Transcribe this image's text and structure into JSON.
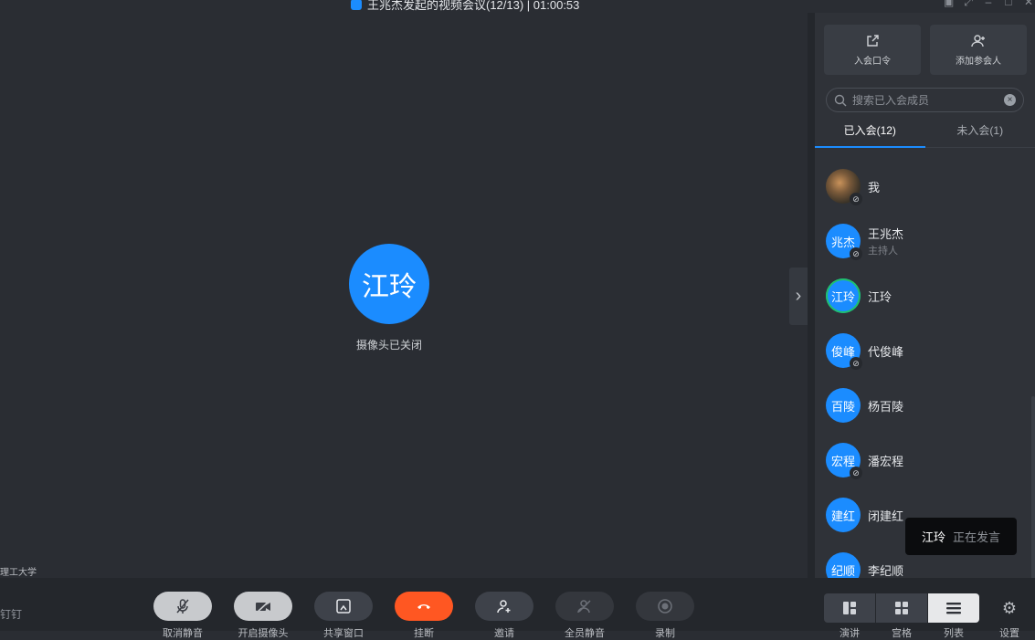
{
  "window": {
    "title": "王兆杰发起的视频会议(12/13) | 01:00:53"
  },
  "stage": {
    "speaker_avatar_text": "江玲",
    "camera_status": "摄像头已关闭",
    "org_label": "理工大学"
  },
  "sidebar": {
    "actions": [
      {
        "label": "入会口令",
        "icon": "external-link-icon"
      },
      {
        "label": "添加参会人",
        "icon": "add-user-icon"
      }
    ],
    "search_placeholder": "搜索已入会成员",
    "tabs": [
      {
        "label": "已入会(12)",
        "active": true
      },
      {
        "label": "未入会(1)",
        "active": false
      }
    ],
    "members": [
      {
        "avatar": "",
        "name": "我",
        "role": "",
        "muted": true,
        "photo": true
      },
      {
        "avatar": "兆杰",
        "name": "王兆杰",
        "role": "主持人",
        "muted": true
      },
      {
        "avatar": "江玲",
        "name": "江玲",
        "role": "",
        "muted": false,
        "speaking": true
      },
      {
        "avatar": "俊峰",
        "name": "代俊峰",
        "role": "",
        "muted": true
      },
      {
        "avatar": "百陵",
        "name": "杨百陵",
        "role": "",
        "muted": false
      },
      {
        "avatar": "宏程",
        "name": "潘宏程",
        "role": "",
        "muted": true
      },
      {
        "avatar": "建红",
        "name": "闭建红",
        "role": "",
        "muted": false
      },
      {
        "avatar": "纪顺",
        "name": "李纪顺",
        "role": "",
        "muted": false
      }
    ]
  },
  "speaking_toast": {
    "name": "江玲",
    "status": "正在发言"
  },
  "toolbar": {
    "pin_label": "钉钉",
    "buttons": [
      {
        "label": "取消静音",
        "icon": "mic-off-icon"
      },
      {
        "label": "开启摄像头",
        "icon": "camera-off-icon"
      },
      {
        "label": "共享窗口",
        "icon": "share-screen-icon"
      },
      {
        "label": "挂断",
        "icon": "hang-up-icon"
      },
      {
        "label": "邀请",
        "icon": "invite-icon"
      },
      {
        "label": "全员静音",
        "icon": "mute-all-icon"
      },
      {
        "label": "录制",
        "icon": "record-icon"
      }
    ],
    "layouts": [
      {
        "label": "演讲",
        "icon": "speaker-layout-icon"
      },
      {
        "label": "宫格",
        "icon": "grid-layout-icon"
      },
      {
        "label": "列表",
        "icon": "list-layout-icon",
        "active": true
      }
    ],
    "settings_label": "设置"
  },
  "colors": {
    "accent": "#1b8cff",
    "hangup": "#ff5722",
    "background": "#2a2d33"
  }
}
